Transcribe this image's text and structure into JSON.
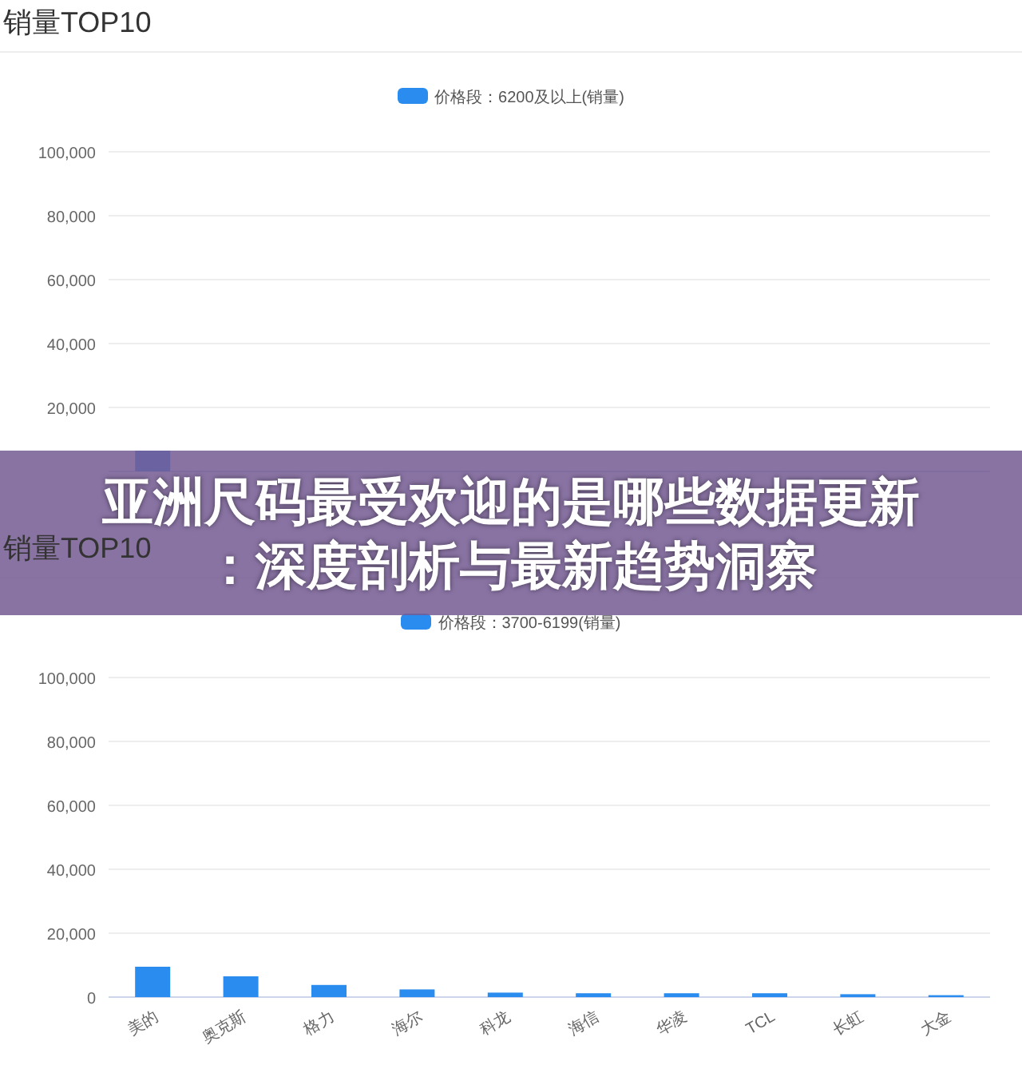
{
  "panels": [
    {
      "title": "销量TOP10",
      "chart_data": {
        "type": "bar",
        "grid": true,
        "ylim": [
          0,
          100000
        ],
        "yticks": [
          {
            "value": 20000,
            "label": "20,000"
          },
          {
            "value": 40000,
            "label": "40,000"
          },
          {
            "value": 60000,
            "label": "60,000"
          },
          {
            "value": 80000,
            "label": "80,000"
          },
          {
            "value": 100000,
            "label": "100,000"
          }
        ],
        "series": [
          {
            "name": "价格段：6200及以上(销量)",
            "color": "#2a8cef",
            "values": [
              6500,
              null,
              null,
              null,
              null,
              null,
              null,
              null,
              null,
              null
            ]
          }
        ]
      }
    },
    {
      "title": "销量TOP10",
      "chart_data": {
        "type": "bar",
        "grid": true,
        "ylim": [
          0,
          100000
        ],
        "yticks": [
          {
            "value": 0,
            "label": "0"
          },
          {
            "value": 20000,
            "label": "20,000"
          },
          {
            "value": 40000,
            "label": "40,000"
          },
          {
            "value": 60000,
            "label": "60,000"
          },
          {
            "value": 80000,
            "label": "80,000"
          },
          {
            "value": 100000,
            "label": "100,000"
          }
        ],
        "categories": [
          "美的",
          "奥克斯",
          "格力",
          "海尔",
          "科龙",
          "海信",
          "华凌",
          "TCL",
          "长虹",
          "大金"
        ],
        "series": [
          {
            "name": "价格段：3700-6199(销量)",
            "color": "#2a8cef",
            "values": [
              9500,
              6500,
              3800,
              2400,
              1400,
              1200,
              1200,
              1200,
              900,
              600
            ]
          }
        ]
      }
    }
  ],
  "overlay_title_lines": [
    "亚洲尺码最受欢迎的是哪些数据更新",
    "：深度剖析与最新趋势洞察"
  ]
}
